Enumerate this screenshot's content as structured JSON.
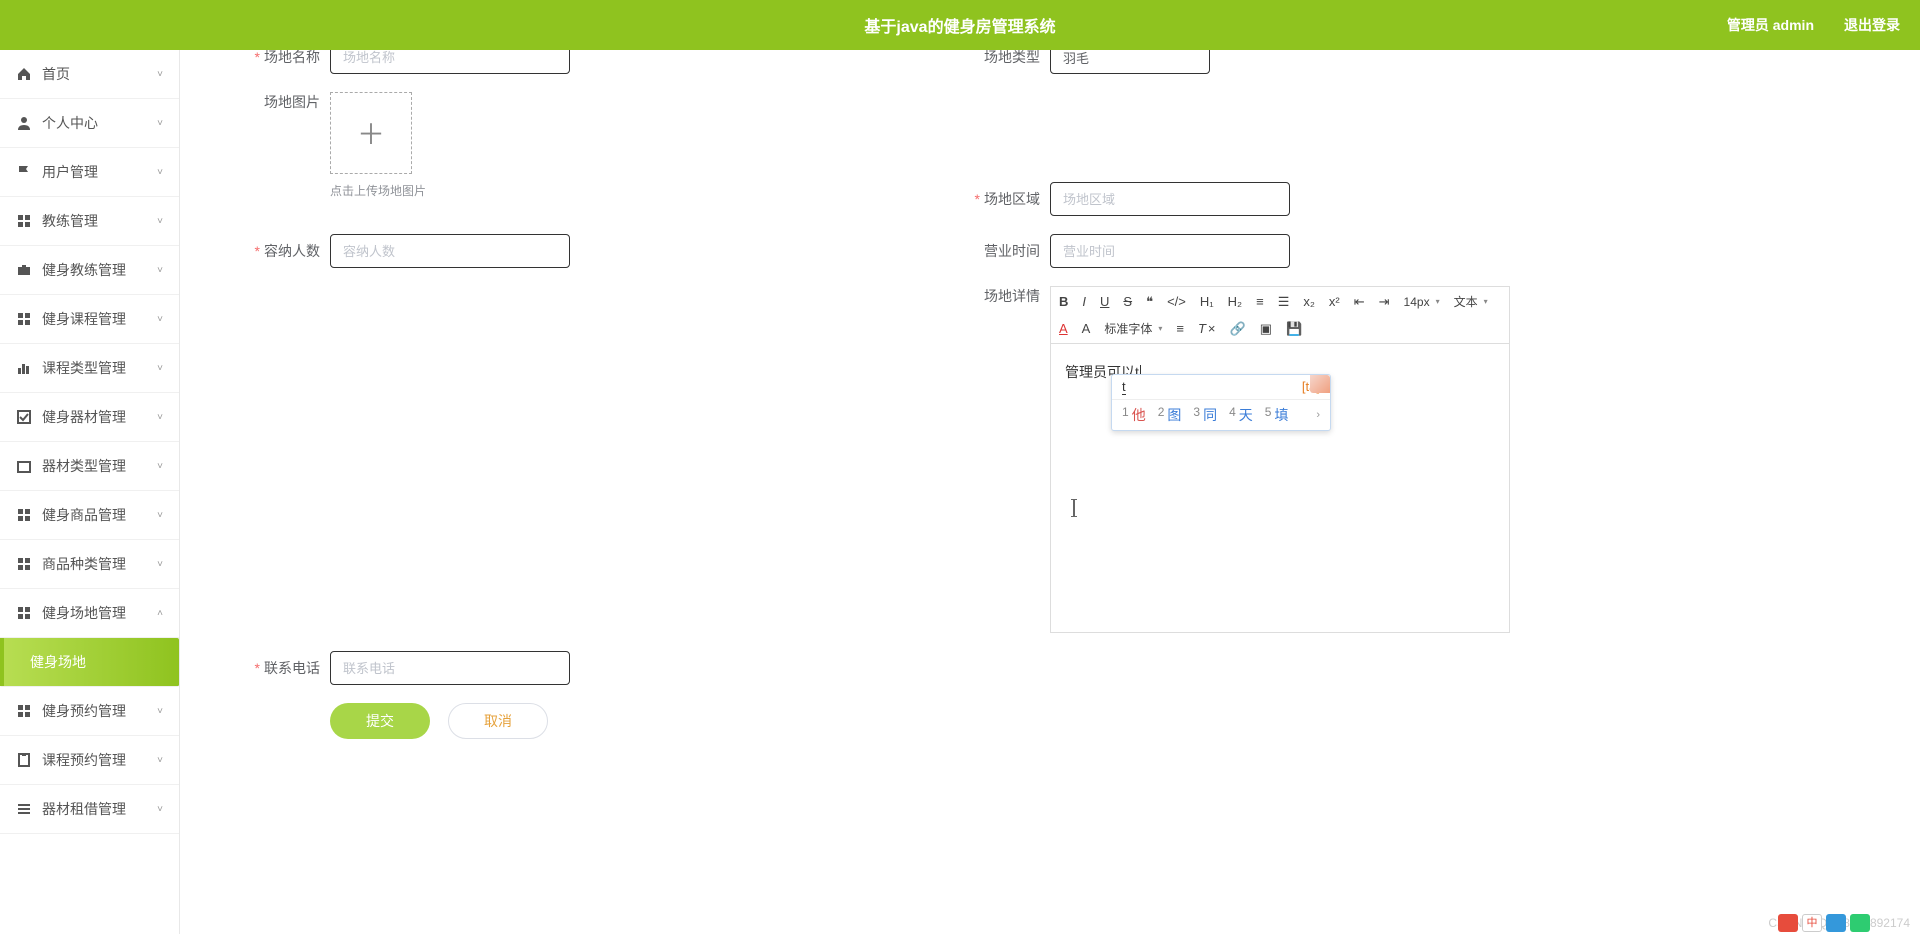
{
  "header": {
    "title": "基于java的健身房管理系统",
    "admin_label": "管理员 admin",
    "logout_label": "退出登录"
  },
  "sidebar": {
    "items": [
      {
        "label": "首页",
        "icon": "home"
      },
      {
        "label": "个人中心",
        "icon": "person"
      },
      {
        "label": "用户管理",
        "icon": "flag"
      },
      {
        "label": "教练管理",
        "icon": "grid"
      },
      {
        "label": "健身教练管理",
        "icon": "briefcase"
      },
      {
        "label": "健身课程管理",
        "icon": "grid"
      },
      {
        "label": "课程类型管理",
        "icon": "bar"
      },
      {
        "label": "健身器材管理",
        "icon": "check"
      },
      {
        "label": "器材类型管理",
        "icon": "box"
      },
      {
        "label": "健身商品管理",
        "icon": "grid"
      },
      {
        "label": "商品种类管理",
        "icon": "grid"
      },
      {
        "label": "健身场地管理",
        "icon": "grid",
        "expanded": true
      },
      {
        "label": "健身场地",
        "active": true
      },
      {
        "label": "健身预约管理",
        "icon": "grid"
      },
      {
        "label": "课程预约管理",
        "icon": "clipboard"
      },
      {
        "label": "器材租借管理",
        "icon": "list"
      }
    ]
  },
  "form": {
    "venue_name_label": "场地名称",
    "venue_name_ph": "场地名称",
    "venue_type_label": "场地类型",
    "venue_type_value": "羽毛",
    "venue_pic_label": "场地图片",
    "upload_hint": "点击上传场地图片",
    "area_label": "场地区域",
    "area_ph": "场地区域",
    "capacity_label": "容纳人数",
    "capacity_ph": "容纳人数",
    "hours_label": "营业时间",
    "hours_ph": "营业时间",
    "details_label": "场地详情",
    "contact_label": "联系电话",
    "contact_ph": "联系电话",
    "submit": "提交",
    "cancel": "取消"
  },
  "editor": {
    "font_size": "14px",
    "text_dd": "文本",
    "font_dd": "标准字体",
    "content": "管理员可以",
    "typing": "t"
  },
  "ime": {
    "typed": "t",
    "bracket": "[ta]",
    "candidates": [
      {
        "num": "1",
        "ch": "他"
      },
      {
        "num": "2",
        "ch": "图"
      },
      {
        "num": "3",
        "ch": "同"
      },
      {
        "num": "4",
        "ch": "天"
      },
      {
        "num": "5",
        "ch": "填"
      }
    ]
  },
  "watermark": "CSDN @QQ58359892174"
}
